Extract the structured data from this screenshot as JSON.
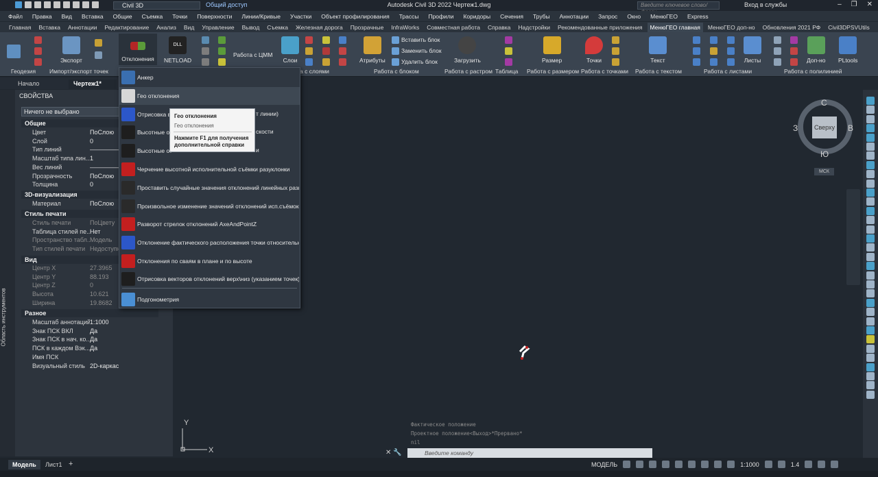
{
  "title_bar": {
    "workspace": "Civil 3D",
    "share": "Общий доступ",
    "app_title": "Autodesk Civil 3D 2022   Чертеж1.dwg",
    "search_placeholder": "Введите ключевое слово/фразу",
    "login": "Вход в службы"
  },
  "menu": [
    "Файл",
    "Правка",
    "Вид",
    "Вставка",
    "Общие",
    "Съемка",
    "Точки",
    "Поверхности",
    "Линии/Кривые",
    "Участки",
    "Объект профилирования",
    "Трассы",
    "Профили",
    "Коридоры",
    "Сечения",
    "Трубы",
    "Аннотации",
    "Запрос",
    "Окно",
    "МенюГЕО",
    "Express"
  ],
  "ribbon_tabs": [
    "Главная",
    "Вставка",
    "Аннотации",
    "Редактирование",
    "Анализ",
    "Вид",
    "Управление",
    "Вывод",
    "Съемка",
    "Железная дорога",
    "Прозрачные",
    "InfraWorks",
    "Совместная работа",
    "Справка",
    "Надстройки",
    "Рекомендованные приложения",
    "МенюГЕО главная",
    "МенюГЕО доп-но",
    "Обновления 2021 РФ",
    "Civil3DPSVUtils"
  ],
  "active_ribbon_tab": "МенюГЕО главная",
  "ribbon": {
    "buttons": {
      "export": "Экспорт",
      "deviations": "Отклонения",
      "netload": "NETLOAD",
      "dtm": "Работа с ЦММ",
      "layers": "Слои",
      "attributes": "Атрибуты",
      "insert_block": "Вставить блок",
      "replace_block": "Заменить блок",
      "delete_block": "Удалить блок",
      "load": "Загрузить",
      "size": "Размер",
      "points": "Точки",
      "text": "Текст",
      "sheets": "Листы",
      "extra": "Доп-но",
      "pltools": "PLtools",
      "netload_icon_text": "DLL"
    },
    "panels": [
      "Геодезия",
      "Импорт/экспорт точек",
      "а с слоями",
      "Работа с блоком",
      "Работа с растром",
      "Таблица",
      "Работа с размером",
      "Работа с точками",
      "Работа с текстом",
      "Работа с листами",
      "Работа с полилинией"
    ]
  },
  "doc_tabs": {
    "start": "Начало",
    "drawing": "Чертеж1*"
  },
  "palette": {
    "side_label": "Область инструментов",
    "title": "СВОЙСТВА",
    "selection": "Ничего не выбрано",
    "sections": {
      "general": "Общие",
      "viz3d": "3D-визуализация",
      "plot": "Стиль печати",
      "view": "Вид",
      "misc": "Разное"
    },
    "general": [
      {
        "k": "Цвет",
        "v": "ПоСлою"
      },
      {
        "k": "Слой",
        "v": "0"
      },
      {
        "k": "Тип линий",
        "v": "——————"
      },
      {
        "k": "Масштаб типа лин...",
        "v": "1"
      },
      {
        "k": "Вес линий",
        "v": "——————"
      },
      {
        "k": "Прозрачность",
        "v": "ПоСлою"
      },
      {
        "k": "Толщина",
        "v": "0"
      }
    ],
    "viz3d": [
      {
        "k": "Материал",
        "v": "ПоСлою"
      }
    ],
    "plot": [
      {
        "k": "Стиль печати",
        "v": "ПоЦвету"
      },
      {
        "k": "Таблица стилей пе...",
        "v": "Нет"
      },
      {
        "k": "Пространство табл...",
        "v": "Модель"
      },
      {
        "k": "Тип стилей печати",
        "v": "Недоступно"
      }
    ],
    "view": [
      {
        "k": "Центр X",
        "v": "27.3965"
      },
      {
        "k": "Центр Y",
        "v": "88.193"
      },
      {
        "k": "Центр Z",
        "v": "0"
      },
      {
        "k": "Высота",
        "v": "10.621"
      },
      {
        "k": "Ширина",
        "v": "19.8682"
      }
    ],
    "misc": [
      {
        "k": "Масштаб аннотаций",
        "v": "1:1000"
      },
      {
        "k": "Знак ПСК ВКЛ",
        "v": "Да"
      },
      {
        "k": "Знак ПСК в нач. ко...",
        "v": "Да"
      },
      {
        "k": "ПСК в каждом Вэк...",
        "v": "Да"
      },
      {
        "k": "Имя ПСК",
        "v": ""
      },
      {
        "k": "Визуальный стиль",
        "v": "2D-каркас"
      }
    ]
  },
  "dropdown": [
    "Анкер",
    "Гео отклонения",
    "Отрисовка ве",
    "Высотные от",
    "Высотные от",
    "Черчение высотной исполнительной съёмки разуклонки",
    "Проставить случайные значения отклонений линейных размеров",
    "Произвольное изменение значений отклонений исп.съёмок",
    "Разворот стрелок отклонений AxeAndPointZ",
    "Отклонение фактического расположения точки относительно з",
    "Отклонения по сваям в плане и по высоте",
    "Отрисовка векторов отклонений верх\\низ (указанием точек)",
    "Подгонометрия"
  ],
  "dropdown_hidden_tails": [
    "т линии)",
    "скости",
    "и"
  ],
  "tooltip": {
    "title": "Гео отклонения",
    "subtitle": "Гео отклонения",
    "help": "Нажмите F1 для получения дополнительной справки"
  },
  "viewcube": {
    "north": "С",
    "south": "Ю",
    "west": "З",
    "east": "В",
    "face": "Сверху",
    "ucs": "МСК"
  },
  "command": {
    "history": [
      "Фактическое положение",
      "Проектное положение<Выход>*Прервано*",
      "nil"
    ],
    "placeholder": "Введите команду"
  },
  "status": {
    "model_tab": "Модель",
    "layout_tab": "Лист1",
    "model_label": "МОДЕЛЬ",
    "scale": "1:1000",
    "zoom": "1.4"
  },
  "ucs_icon": {
    "x": "X",
    "y": "Y"
  },
  "colors": {
    "background": "#212830",
    "ribbon": "#3a4450",
    "palette": "#2d343d",
    "accent": "#3e4853"
  }
}
